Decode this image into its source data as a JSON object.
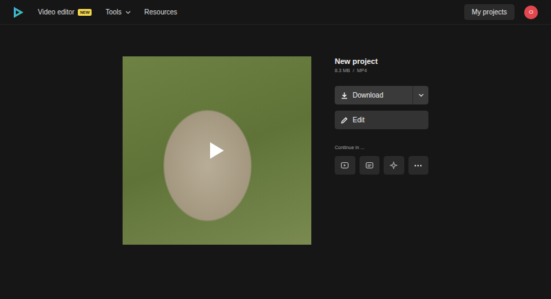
{
  "header": {
    "nav": [
      {
        "label": "Video editor",
        "badge": "NEW",
        "dropdown": false
      },
      {
        "label": "Tools",
        "badge": null,
        "dropdown": true
      },
      {
        "label": "Resources",
        "badge": null,
        "dropdown": false
      }
    ],
    "my_projects": "My projects",
    "avatar": "O"
  },
  "project": {
    "title": "New project",
    "size": "8.3 MB",
    "separator": "/",
    "format": "MP4"
  },
  "actions": {
    "download": "Download",
    "edit": "Edit"
  },
  "continue": {
    "label": "Continue in ...",
    "targets": [
      {
        "kind": "video"
      },
      {
        "kind": "captions"
      },
      {
        "kind": "sparkle"
      },
      {
        "kind": "more"
      }
    ]
  }
}
